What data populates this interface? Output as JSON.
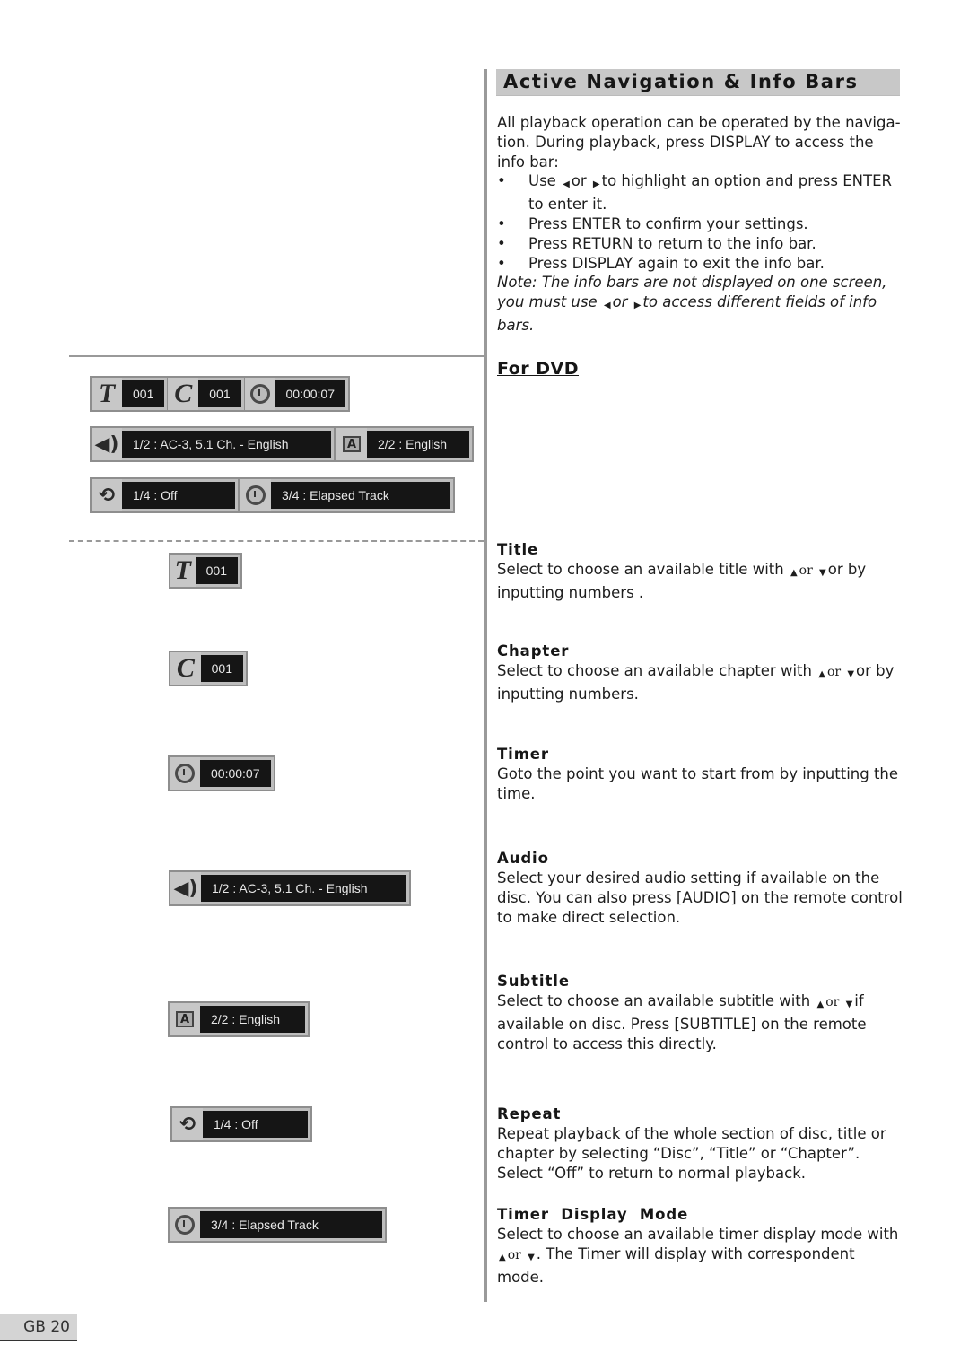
{
  "header": {
    "section_title": "Active Navigation & Info Bars"
  },
  "intro": {
    "paragraph": "All playback operation can be operated by the naviga-tion. During playback, press DISPLAY to access the info bar:",
    "bullets": [
      {
        "pre": "Use",
        "mid": "or",
        "post": "to highlight an option and press ENTER to enter it."
      },
      {
        "text": "Press ENTER to confirm your settings."
      },
      {
        "text": "Press RETURN to return to the info bar."
      },
      {
        "text": "Press DISPLAY again to exit the info bar."
      }
    ],
    "note": {
      "pre": "Note: The info bars are not displayed on one screen, you must use",
      "mid": "or",
      "post": "to access different fields of info bars."
    },
    "bullet_symbol": "•"
  },
  "subsection_title": "For DVD",
  "icons": {
    "left_arrow": "◀",
    "right_arrow": "▶",
    "up_arrow": "▲",
    "down_arrow": "▼"
  },
  "osd_overview": {
    "row1": {
      "title_icon": "T",
      "title_value": "001",
      "chapter_icon": "C",
      "chapter_value": "001",
      "timer_value": "00:00:07"
    },
    "row2": {
      "audio_value": "1/2 : AC-3, 5.1 Ch. - English",
      "subtitle_icon": "A",
      "subtitle_value": "2/2 : English"
    },
    "row3": {
      "repeat_value": "1/4 : Off",
      "timer_mode_value": "3/4 : Elapsed Track"
    }
  },
  "items": [
    {
      "heading": "Title",
      "pre": "Select to choose an available title with",
      "mid": "or",
      "post": "or by inputting numbers .",
      "osd_icon": "T",
      "osd_value": "001"
    },
    {
      "heading": "Chapter",
      "pre": "Select to choose an available chapter with",
      "mid": "or",
      "post": "or by inputting numbers.",
      "osd_icon": "C",
      "osd_value": "001"
    },
    {
      "heading": "Timer",
      "text": "Goto the point you want to start from by inputting the time.",
      "osd_value": "00:00:07"
    },
    {
      "heading": "Audio",
      "text": "Select your desired audio setting if available on the disc. You can also press [AUDIO] on the remote control to make direct selection.",
      "osd_value": "1/2 : AC-3, 5.1 Ch. - English"
    },
    {
      "heading": "Subtitle",
      "pre": "Select to choose an available subtitle with",
      "mid": "or",
      "post": "if available on disc. Press [SUBTITLE] on the remote control to access this directly.",
      "osd_icon": "A",
      "osd_value": "2/2 : English"
    },
    {
      "heading": "Repeat",
      "text": "Repeat playback of the whole section of disc, title or chapter by selecting “Disc”, “Title” or “Chapter”. Select “Off” to return to normal playback.",
      "osd_value": "1/4 : Off"
    },
    {
      "heading": "Timer  Display  Mode",
      "pre": "Select to choose an available timer display mode with",
      "mid": "or",
      "post": ". The Timer will display with correspondent mode.",
      "osd_value": "3/4 : Elapsed Track"
    }
  ],
  "footer": {
    "page_number": "GB 20"
  }
}
